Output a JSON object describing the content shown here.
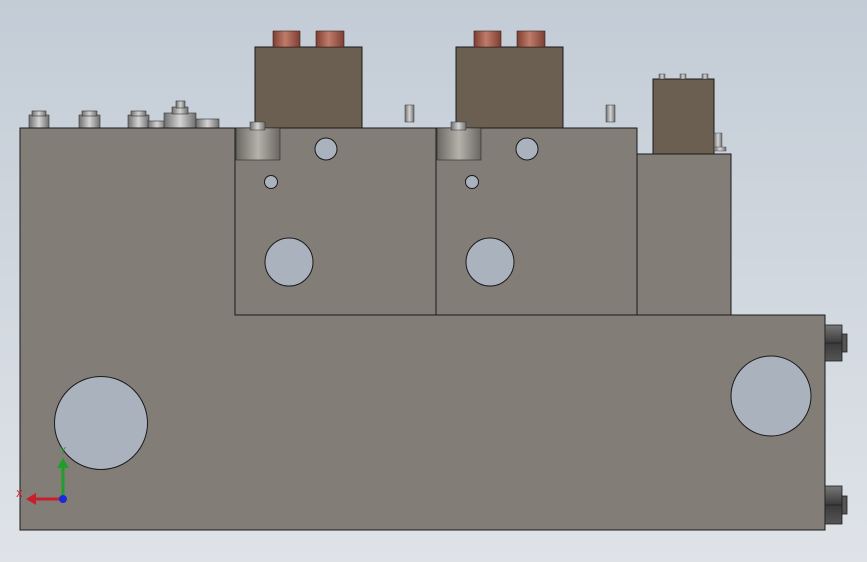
{
  "viewport": {
    "background_top": "#c3ccd6",
    "background_bottom": "#dfe3e8"
  },
  "colors": {
    "body_fill": "#827d77",
    "body_stroke": "#1a1a1a",
    "solenoid_fill": "#6b5f52",
    "coil_cap_fill": "#9a5a4c",
    "hole_fill": "#aab3bd",
    "bolt_fill": "#4a4a4a"
  },
  "triad": {
    "x_label": "X",
    "y_label": "Y",
    "x_color": "#c8202a",
    "y_color": "#1f9e2a",
    "z_color": "#1a2ad8"
  }
}
